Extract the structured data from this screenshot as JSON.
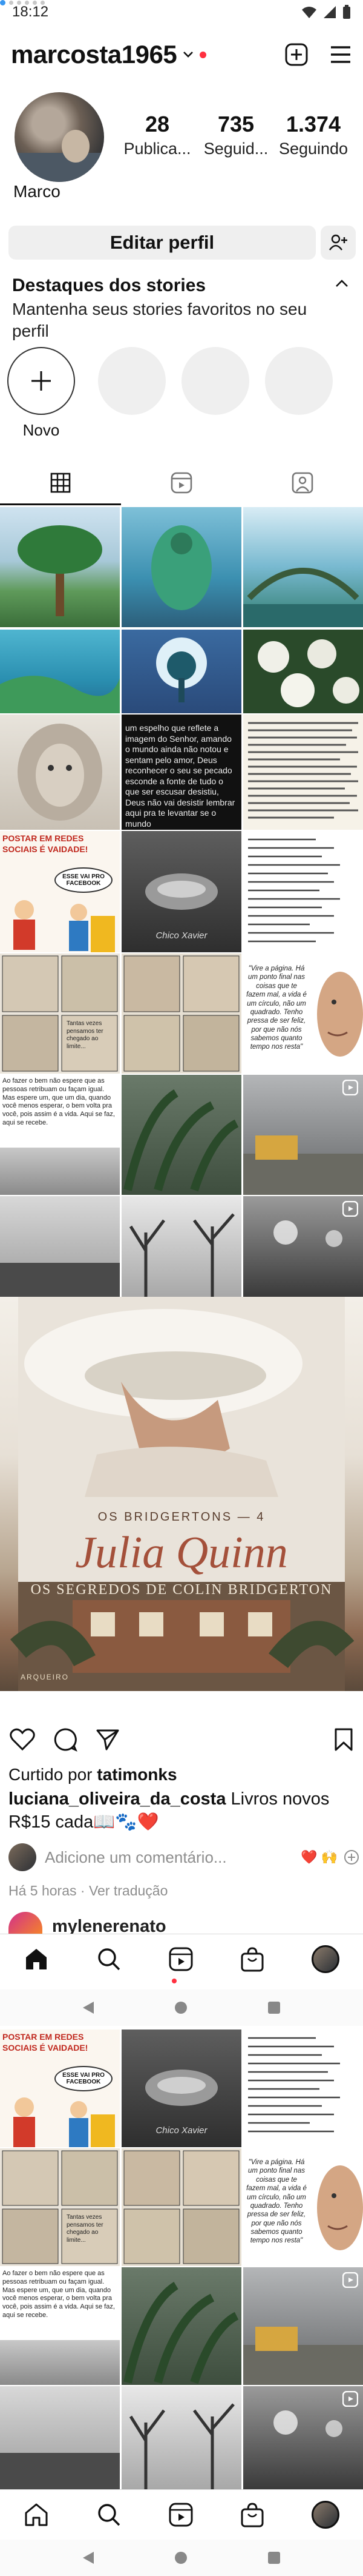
{
  "status_bar": {
    "time": "18:12"
  },
  "profile": {
    "username": "marcosta1965",
    "display_name": "Marco",
    "stats": [
      {
        "value": "28",
        "label": "Publica..."
      },
      {
        "value": "735",
        "label": "Seguid..."
      },
      {
        "value": "1.374",
        "label": "Seguindo"
      }
    ],
    "edit_button": "Editar perfil"
  },
  "highlights": {
    "title": "Destaques dos stories",
    "subtitle": "Mantenha seus stories favoritos no seu perfil",
    "new_label": "Novo"
  },
  "grid_text": {
    "gospel_quote": "um espelho que reflete a imagem do Senhor, amando o mundo ainda não notou e sentam pelo amor, Deus reconhecer o seu se pecado esconde a fonte de tudo o que ser escusar desistiu, Deus não vai desistir lembrar aqui pra te levantar se o mundo",
    "social_heading": "POSTAR EM REDES SOCIAIS É VAIDADE!",
    "speech_bubble": "ESSE VAI PRO FACEBOOK",
    "author": "Chico Xavier",
    "comic_text": "Tantas vezes pensamos ter chegado ao limite...",
    "favor_text": "Ao fazer o bem não espere que as pessoas retribuam ou façam igual. Mas espere um, que um dia, quando você menos esperar, o bem volta pra você, pois assim é a vida. Aqui se faz, aqui se recebe.",
    "page_quote": "\"Vire a página. Há um ponto final nas coisas que te fazem mal, a vida é um círculo, não um quadrado. Tenho pressa de ser feliz, por que não nós sabemos quanto tempo nos resta\""
  },
  "post": {
    "book_series": "OS BRIDGERTONS — 4",
    "book_author": "Julia Quinn",
    "book_title": "OS SEGREDOS DE COLIN BRIDGERTON",
    "publisher": "ARQUEIRO",
    "liked_prefix": "Curtido por ",
    "liked_user": "tatimonks",
    "caption_user": "luciana_oliveira_da_costa",
    "caption_text": " Livros novos R$15 cada📖🐾❤️",
    "comment_placeholder": "Adicione um comentário...",
    "comment_emojis": "❤️ 🙌",
    "meta": "Há 5 horas · Ver tradução",
    "next_user": "mylenerenato"
  },
  "colors": {
    "accent_blue": "#3897f0",
    "notification_red": "#ff3040",
    "button_gray": "#efefef"
  },
  "icons": [
    "plus-square-icon",
    "menu-icon",
    "grid-icon",
    "reels-icon",
    "tagged-icon",
    "heart-icon",
    "comment-icon",
    "share-icon",
    "bookmark-icon",
    "home-icon",
    "search-icon",
    "shop-icon"
  ]
}
